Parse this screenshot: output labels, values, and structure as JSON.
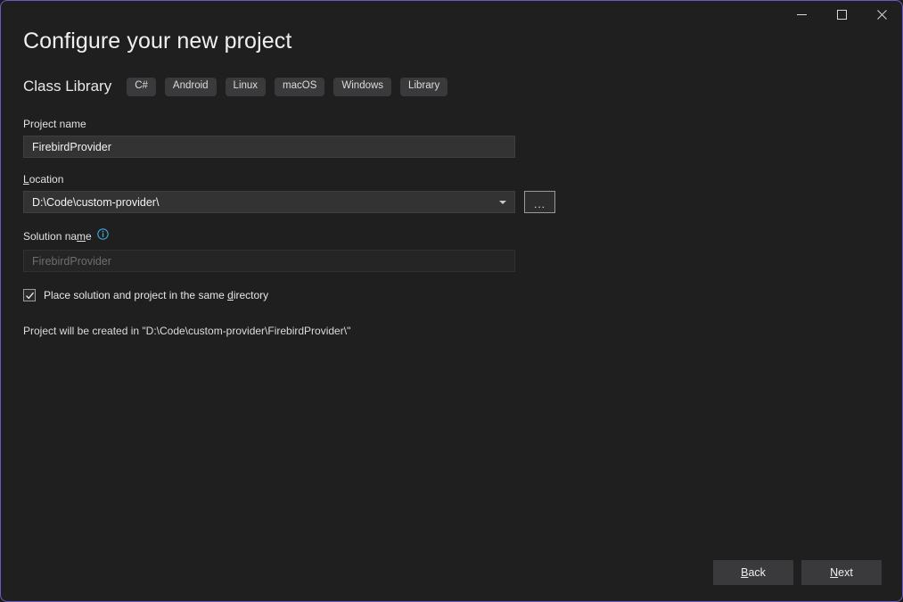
{
  "window": {
    "accent_border_color": "#6b5bbd",
    "background_color": "#1f1f20",
    "controls": [
      {
        "name": "minimize",
        "icon": "minimize-icon"
      },
      {
        "name": "maximize",
        "icon": "maximize-icon"
      },
      {
        "name": "close",
        "icon": "close-icon"
      }
    ]
  },
  "header": {
    "title": "Configure your new project",
    "template_name": "Class Library",
    "tags": [
      "C#",
      "Android",
      "Linux",
      "macOS",
      "Windows",
      "Library"
    ]
  },
  "form": {
    "project_name": {
      "label": "Project name",
      "value": "FirebirdProvider",
      "placeholder": ""
    },
    "location": {
      "label_before": "",
      "label_accesskey": "L",
      "label_after": "ocation",
      "value": "D:\\Code\\custom-provider\\",
      "browse_button_label": "...",
      "caret_icon": "chevron-down-icon"
    },
    "solution_name": {
      "label_before": "Solution na",
      "label_accesskey": "m",
      "label_after": "e",
      "value": "",
      "placeholder": "FirebirdProvider",
      "disabled": true,
      "info_icon": "info-icon",
      "info_icon_color": "#3fa9d8"
    },
    "same_directory_checkbox": {
      "checked": true,
      "label_before": "Place solution and project in the same ",
      "label_accesskey": "d",
      "label_after": "irectory"
    },
    "note": "Project will be created in \"D:\\Code\\custom-provider\\FirebirdProvider\\\""
  },
  "footer": {
    "back": {
      "before": "",
      "accesskey": "B",
      "after": "ack"
    },
    "next": {
      "before": "",
      "accesskey": "N",
      "after": "ext"
    }
  }
}
